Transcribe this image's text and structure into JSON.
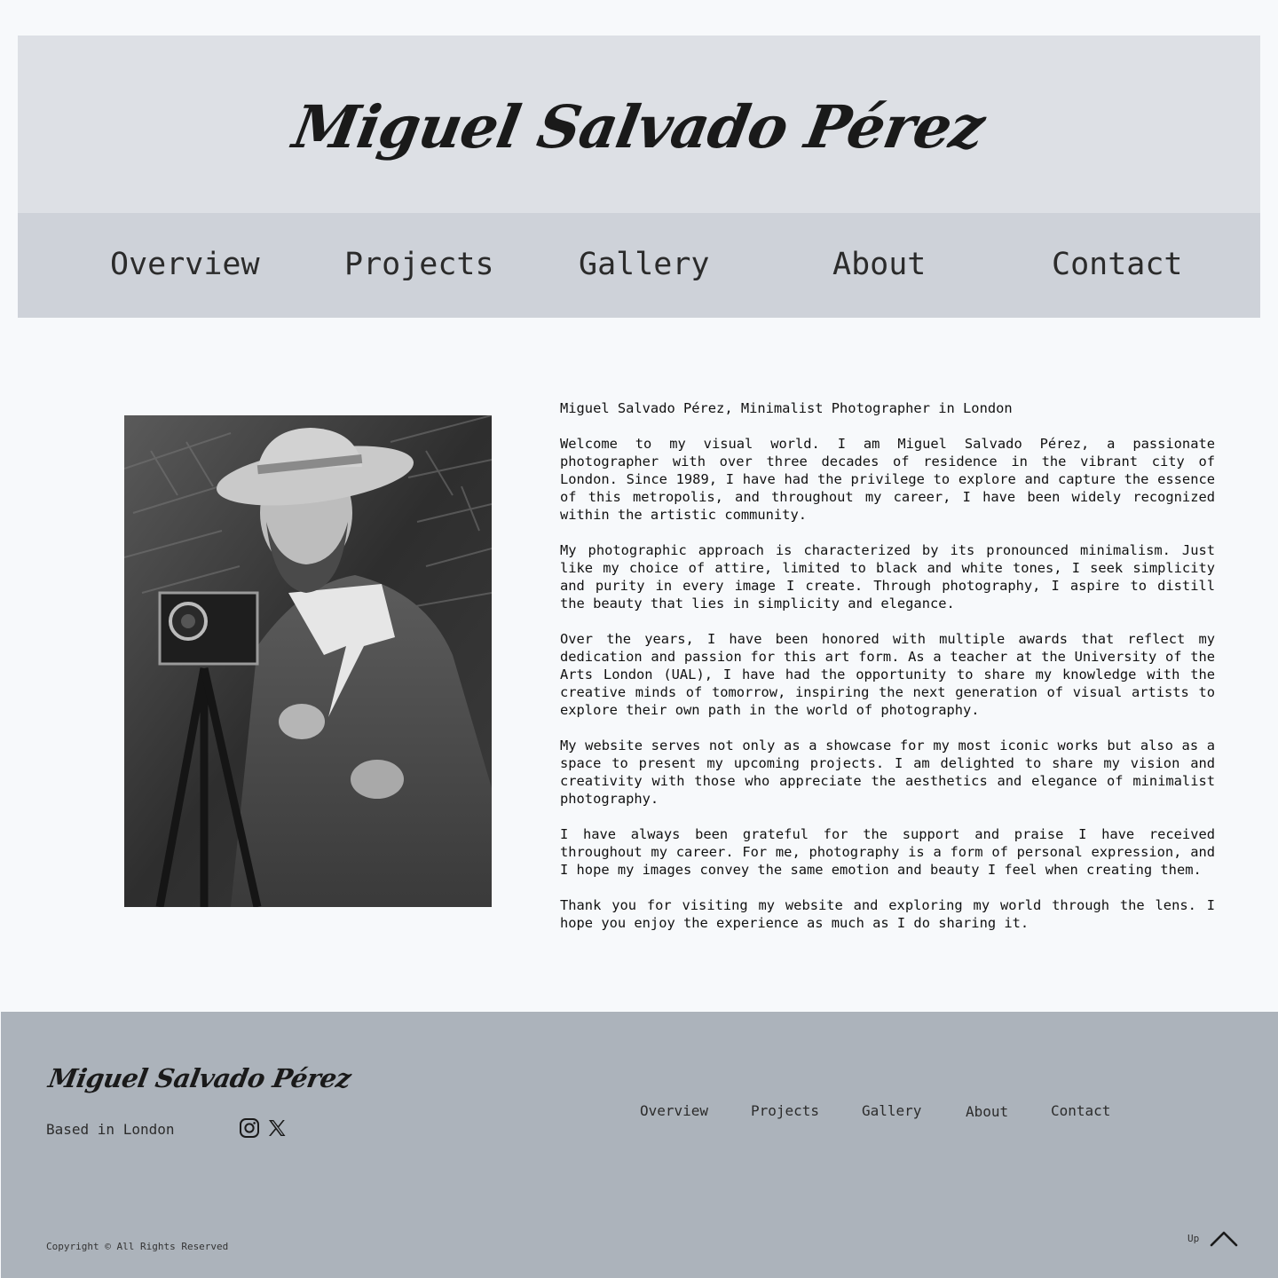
{
  "site": {
    "name": "Miguel Salvado Pérez"
  },
  "nav": {
    "items": [
      "Overview",
      "Projects",
      "Gallery",
      "About",
      "Contact"
    ]
  },
  "bio": {
    "heading": "Miguel Salvado Pérez, Minimalist Photographer in London",
    "paragraphs": [
      "Welcome to my visual world. I am Miguel Salvado Pérez, a passionate photographer with over three decades of residence in the vibrant city of London. Since 1989, I have had the privilege to explore and capture the essence of this metropolis, and throughout my career, I have been widely recognized within the artistic community.",
      "My photographic approach is characterized by its pronounced minimalism. Just like my choice of attire, limited to black and white tones, I seek simplicity and purity in every image I create. Through photography, I aspire to distill the beauty that lies in simplicity and elegance.",
      "Over the years, I have been honored with multiple awards that reflect my dedication and passion for this art form. As a teacher at the University of the Arts London (UAL), I have had the opportunity to share my knowledge with the creative minds of tomorrow, inspiring the next generation of visual artists to explore their own path in the world of photography.",
      "My website serves not only as a showcase for my most iconic works but also as a space to present my upcoming projects. I am delighted to share my vision and creativity with those who appreciate the aesthetics and elegance of minimalist photography.",
      "I have always been grateful for the support and praise I have received throughout my career. For me, photography is a form of personal expression, and I hope my images convey the same emotion and beauty I feel when creating them.",
      "Thank you for visiting my website and exploring my world through the lens. I hope you enjoy the experience as much as I do sharing it."
    ]
  },
  "footer": {
    "location": "Based in London",
    "social_icons": [
      "instagram-icon",
      "x-icon"
    ],
    "nav_items": [
      "Overview",
      "Projects",
      "Gallery",
      "About",
      "Contact"
    ],
    "copyright": "Copyright © All Rights Reserved",
    "up_label": "Up",
    "up_icon": "chevron-up-icon"
  },
  "colors": {
    "page_bg": "#f7f9fb",
    "header_bg": "#dde0e5",
    "nav_bg": "#ced2d9",
    "footer_bg": "#acb3bb",
    "text": "#161616"
  }
}
